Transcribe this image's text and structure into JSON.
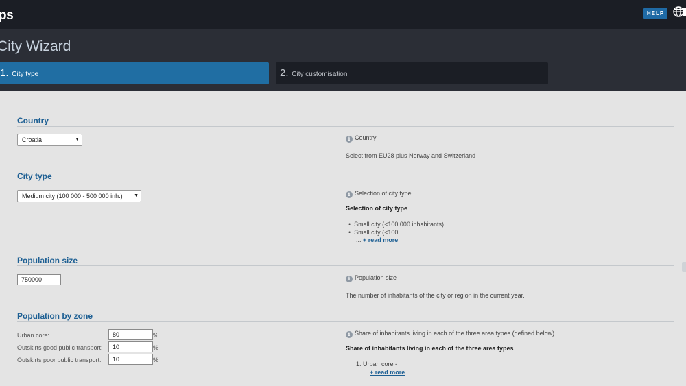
{
  "app": {
    "brand": "ps",
    "help_label": "HELP"
  },
  "wizard": {
    "title": "City Wizard",
    "steps": [
      {
        "num": "1.",
        "label": "City type",
        "active": true
      },
      {
        "num": "2.",
        "label": "City customisation",
        "active": false
      }
    ]
  },
  "country": {
    "section_title": "Country",
    "selected": "Croatia",
    "info_title": "Country",
    "help_text": "Select from EU28 plus Norway and Switzerland"
  },
  "city_type": {
    "section_title": "City type",
    "selected": "Medium city (100 000 - 500 000 inh.)",
    "info_title": "Selection of city type",
    "help_heading": "Selection of city type",
    "bullets": [
      "Small city (<100 000 inhabitants)",
      "Small city (<100"
    ],
    "ellipsis": "...",
    "read_more": "+ read more"
  },
  "population_size": {
    "section_title": "Population size",
    "value": "750000",
    "info_title": "Population size",
    "help_text": "The number of inhabitants of the city or region in the current year."
  },
  "population_by_zone": {
    "section_title": "Population by zone",
    "zones": [
      {
        "label": "Urban core:",
        "value": "80",
        "unit": "%"
      },
      {
        "label": "Outskirts good public transport:",
        "value": "10",
        "unit": "%"
      },
      {
        "label": "Outskirts poor public transport:",
        "value": "10",
        "unit": "%"
      }
    ],
    "info_title": "Share of inhabitants living in each of the three area types (defined below)",
    "help_heading": "Share of inhabitants living in each of the three area types",
    "list_item": "1. Urban core -",
    "ellipsis": "...",
    "read_more": "+ read more"
  },
  "colors": {
    "accent": "#206ea3",
    "topbar": "#1b1e25",
    "header": "#2b2e36",
    "content_bg": "#e4e4e4",
    "section_title": "#1d5f93"
  }
}
